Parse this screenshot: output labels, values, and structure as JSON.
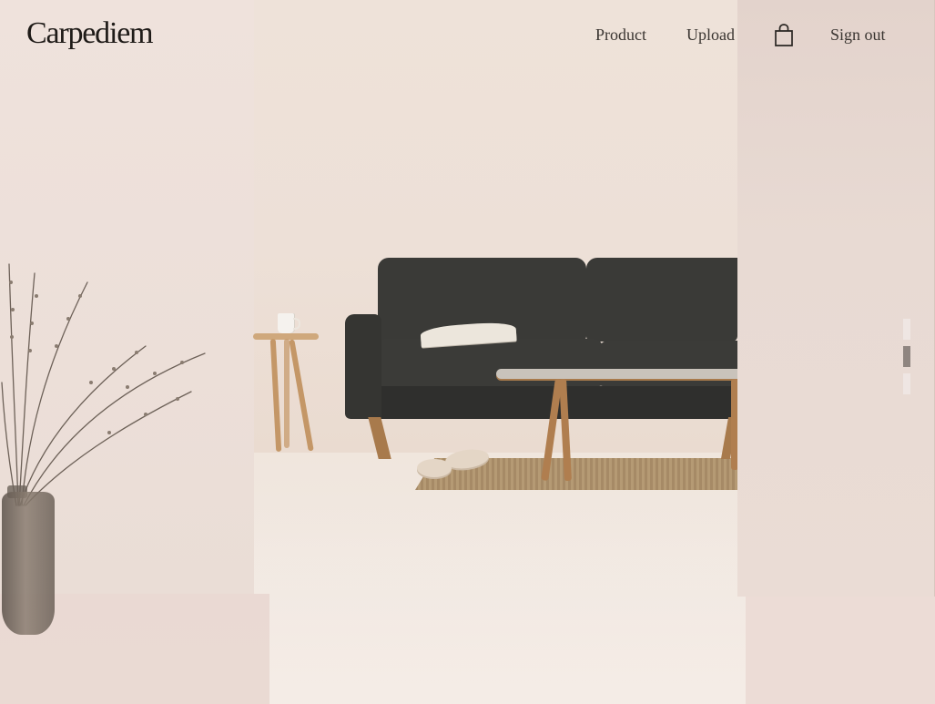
{
  "brand": {
    "name": "Carpediem"
  },
  "nav": {
    "items": [
      {
        "label": "Product"
      },
      {
        "label": "Upload"
      }
    ],
    "cart_icon": "shopping-bag-icon",
    "signout_label": "Sign out"
  },
  "hero": {
    "slides_total": 3,
    "active_slide": 2
  },
  "colors": {
    "text": "#3a3531",
    "brand_text": "#1f1b18",
    "dot_active": "#8f8580",
    "dot_inactive": "#efe6e3"
  }
}
